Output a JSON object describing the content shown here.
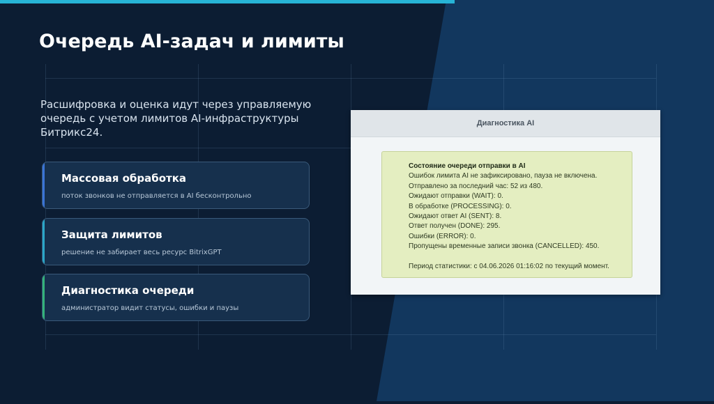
{
  "slide": {
    "title": "Очередь AI-задач и лимиты",
    "subtitle": "Расшифровка и оценка идут через управляемую очередь с учетом лимитов AI-инфраструктуры Битрикс24."
  },
  "cards": [
    {
      "title": "Массовая обработка",
      "description": "поток звонков не отправляется в AI бесконтрольно",
      "accent": "#3a74d6"
    },
    {
      "title": "Защита лимитов",
      "description": "решение не забирает весь ресурс BitrixGPT",
      "accent": "#2ba7c8"
    },
    {
      "title": "Диагностика очереди",
      "description": "администратор видит статусы, ошибки и паузы",
      "accent": "#34b37a"
    }
  ],
  "diagnostics": {
    "header": "Диагностика AI",
    "status_title": "Состояние очереди отправки в AI",
    "lines": [
      "Ошибок лимита AI не зафиксировано, пауза не включена.",
      "Отправлено за последний час: 52 из 480.",
      "Ожидают отправки (WAIT): 0.",
      "В обработке (PROCESSING): 0.",
      "Ожидают ответ AI (SENT): 8.",
      "Ответ получен (DONE): 295.",
      "Ошибки (ERROR): 0.",
      "Пропущены временные записи звонка (CANCELLED): 450."
    ],
    "period": "Период статистики: с 04.06.2026 01:16:02 по текущий момент."
  },
  "colors": {
    "background": "#0c1d33",
    "accent_top": "#27b4d6",
    "panel_bg": "#f2f5f7",
    "status_bg": "#e4eec1"
  }
}
